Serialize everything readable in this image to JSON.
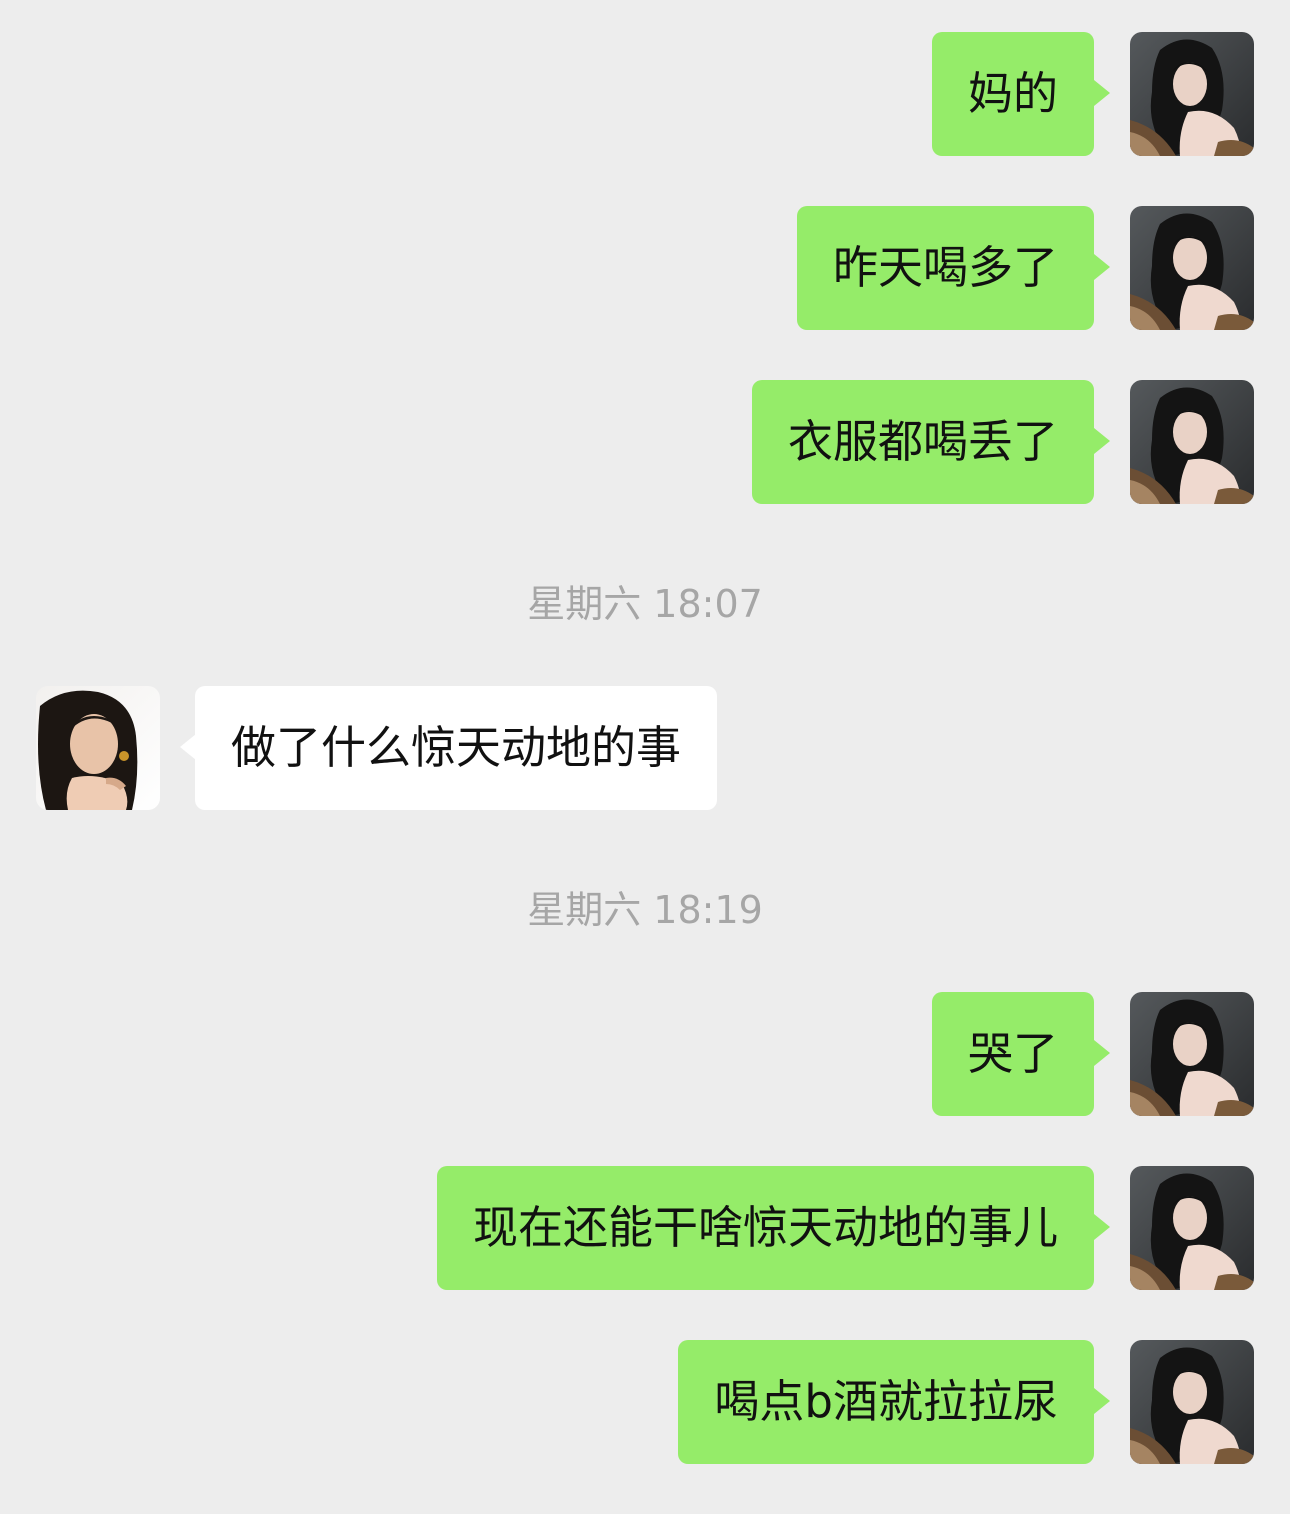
{
  "conversation": {
    "messages_group_1": [
      {
        "sender": "self",
        "text": "妈的"
      },
      {
        "sender": "self",
        "text": "昨天喝多了"
      },
      {
        "sender": "self",
        "text": "衣服都喝丢了"
      }
    ],
    "timestamp_1": "星期六 18:07",
    "reply": {
      "sender": "other",
      "text": "做了什么惊天动地的事"
    },
    "timestamp_2": "星期六 18:19",
    "messages_group_2": [
      {
        "sender": "self",
        "text": "哭了"
      },
      {
        "sender": "self",
        "text": "现在还能干啥惊天动地的事儿"
      },
      {
        "sender": "self",
        "text": "喝点b酒就拉拉尿"
      }
    ]
  },
  "colors": {
    "background": "#ededed",
    "self_bubble": "#95ec69",
    "other_bubble": "#ffffff",
    "timestamp_text": "#a6a6a6"
  },
  "icons": {
    "self_avatar": "portrait-photo-avatar",
    "other_avatar": "portrait-photo-avatar"
  }
}
